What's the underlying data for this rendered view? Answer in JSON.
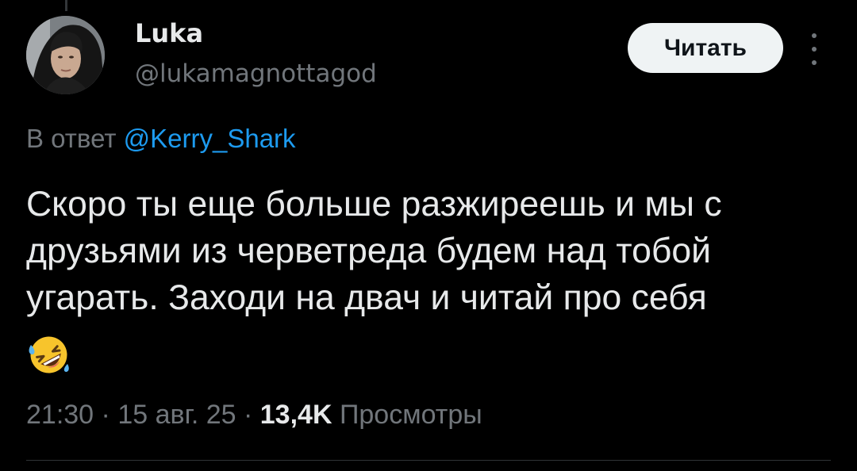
{
  "author": {
    "display_name": "Luka",
    "handle": "@lukamagnottagod"
  },
  "follow_button_label": "Читать",
  "more_icon": "more-vertical-icon",
  "reply": {
    "prefix": "В ответ",
    "mention": "@Kerry_Shark"
  },
  "tweet": {
    "text": "Скоро ты еще больше разжиреешь и мы с друзьями из черветреда будем над тобой угарать. Заходи на двач и читай про себя",
    "emoji": "rolling-on-floor-laughing-emoji"
  },
  "meta": {
    "time": "21:30",
    "separator": "·",
    "date": "15 авг. 25",
    "views_count": "13,4K",
    "views_label": "Просмотры"
  },
  "colors": {
    "background": "#000000",
    "text_primary": "#e7e9ea",
    "text_secondary": "#71767b",
    "link": "#1d9bf0",
    "button_bg": "#eff3f4",
    "button_text": "#0f1419"
  }
}
